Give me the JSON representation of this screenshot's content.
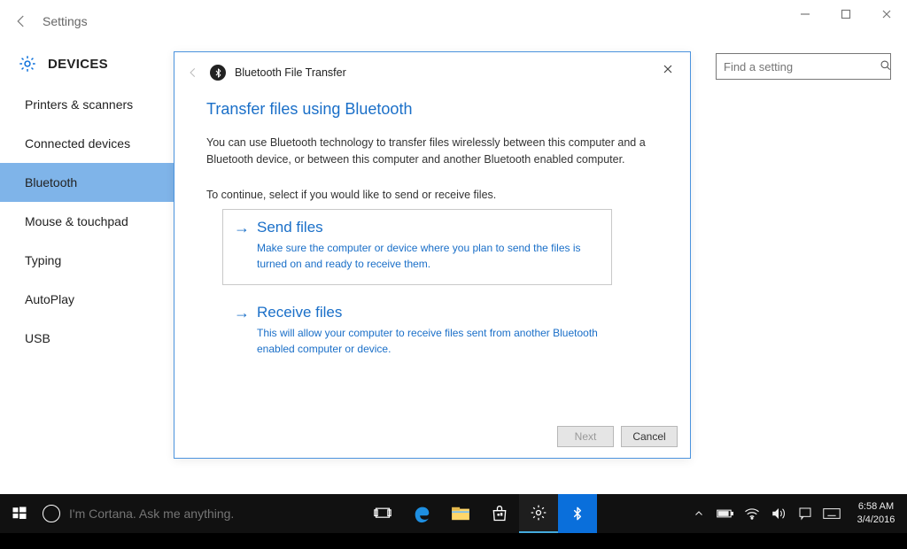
{
  "title": "Settings",
  "header": {
    "title": "DEVICES"
  },
  "search": {
    "placeholder": "Find a setting"
  },
  "sidebar": {
    "items": [
      {
        "label": "Printers & scanners"
      },
      {
        "label": "Connected devices"
      },
      {
        "label": "Bluetooth"
      },
      {
        "label": "Mouse & touchpad"
      },
      {
        "label": "Typing"
      },
      {
        "label": "AutoPlay"
      },
      {
        "label": "USB"
      }
    ],
    "active_index": 2
  },
  "dialog": {
    "title": "Bluetooth File Transfer",
    "heading": "Transfer files using Bluetooth",
    "intro": "You can use Bluetooth technology to transfer files wirelessly between this computer and a Bluetooth device, or between this computer and another Bluetooth enabled computer.",
    "continue": "To continue, select if you would like to send or receive files.",
    "options": [
      {
        "title": "Send files",
        "desc": "Make sure the computer or device where you plan to send the files is turned on and ready to receive them.",
        "selected": true
      },
      {
        "title": "Receive files",
        "desc": "This will allow your computer to receive files sent from another Bluetooth enabled computer or device.",
        "selected": false
      }
    ],
    "buttons": {
      "next": "Next",
      "cancel": "Cancel"
    }
  },
  "taskbar": {
    "cortana_placeholder": "I'm Cortana. Ask me anything.",
    "time": "6:58 AM",
    "date": "3/4/2016"
  }
}
